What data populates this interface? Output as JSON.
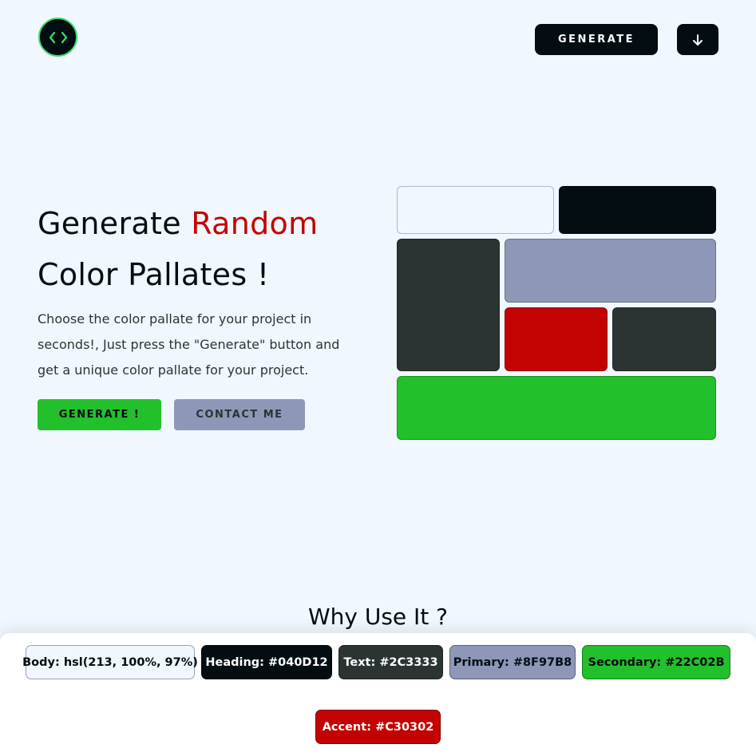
{
  "header": {
    "logo_icon": "code-brackets-icon",
    "generate_label": "GENERATE",
    "download_icon": "arrow-down-icon"
  },
  "hero": {
    "title_part1": "Generate",
    "title_accent": "Random",
    "title_line2": "Color Pallates !",
    "description": "Choose the color pallate for your project in seconds!, Just press the \"Generate\" button and get a unique color pallate for your project.",
    "generate_button": "GENERATE !",
    "contact_button": "CONTACT ME"
  },
  "palette": {
    "body": "#f0f7ff",
    "heading": "#040D12",
    "text": "#2C3333",
    "primary": "#8F97B8",
    "secondary": "#22C02B",
    "accent": "#C30302"
  },
  "section": {
    "title": "Why Use It ?"
  },
  "chips": {
    "body_label": "Body:",
    "body_value": "hsl(213, 100%, 97%)",
    "heading_label": "Heading:",
    "heading_value": "#040D12",
    "text_label": "Text:",
    "text_value": "#2C3333",
    "primary_label": "Primary:",
    "primary_value": "#8F97B8",
    "secondary_label": "Secondary:",
    "secondary_value": "#22C02B",
    "accent_label": "Accent:",
    "accent_value": "#C30302"
  }
}
